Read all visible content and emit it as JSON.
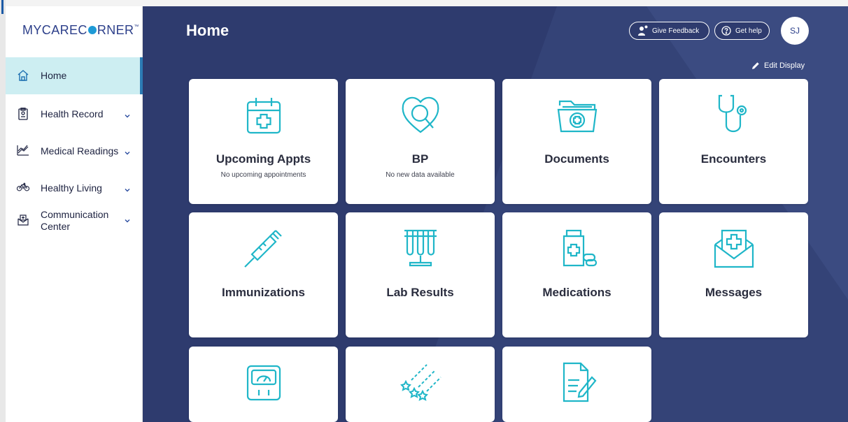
{
  "app": {
    "logo_text_a": "MYCAREC",
    "logo_text_b": "RNER",
    "logo_tm": "™"
  },
  "sidebar": {
    "items": [
      {
        "label": "Home",
        "icon": "home-icon",
        "active": true,
        "has_chevron": false
      },
      {
        "label": "Health Record",
        "icon": "clipboard-icon",
        "active": false,
        "has_chevron": true
      },
      {
        "label": "Medical Readings",
        "icon": "chart-trend-icon",
        "active": false,
        "has_chevron": true
      },
      {
        "label": "Healthy Living",
        "icon": "bicycle-icon",
        "active": false,
        "has_chevron": true
      },
      {
        "label": "Communication Center",
        "icon": "envelope-medical-icon",
        "active": false,
        "has_chevron": true
      }
    ]
  },
  "header": {
    "title": "Home",
    "feedback_label": "Give Feedback",
    "help_label": "Get help",
    "avatar_initials": "SJ",
    "edit_display_label": "Edit Display"
  },
  "tiles": [
    {
      "title": "Upcoming Appts",
      "subtitle": "No upcoming appointments",
      "icon": "calendar-plus-icon"
    },
    {
      "title": "BP",
      "subtitle": "No new data available",
      "icon": "heart-magnifier-icon"
    },
    {
      "title": "Documents",
      "subtitle": "",
      "icon": "folder-medical-icon"
    },
    {
      "title": "Encounters",
      "subtitle": "",
      "icon": "stethoscope-icon"
    },
    {
      "title": "Immunizations",
      "subtitle": "",
      "icon": "syringe-icon"
    },
    {
      "title": "Lab Results",
      "subtitle": "",
      "icon": "test-tubes-icon"
    },
    {
      "title": "Medications",
      "subtitle": "",
      "icon": "pill-bottle-icon"
    },
    {
      "title": "Messages",
      "subtitle": "",
      "icon": "medical-envelope-icon"
    },
    {
      "title": "",
      "subtitle": "",
      "icon": "weight-scale-icon"
    },
    {
      "title": "",
      "subtitle": "",
      "icon": "shooting-stars-icon"
    },
    {
      "title": "",
      "subtitle": "",
      "icon": "document-pencil-icon"
    }
  ],
  "colors": {
    "sidebar_active_bg": "#cdeef2",
    "main_bg": "#2e3b6e",
    "tile_icon": "#1fb6c8",
    "brand": "#2c3f8a"
  }
}
